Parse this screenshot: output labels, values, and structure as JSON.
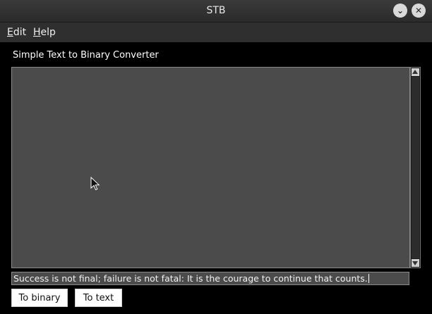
{
  "window": {
    "title": "STB"
  },
  "controls": {
    "minimize_icon": "⌄",
    "close_icon": "✕"
  },
  "menubar": {
    "edit": {
      "mnemonic": "E",
      "rest": "dit"
    },
    "help": {
      "mnemonic": "H",
      "rest": "elp"
    }
  },
  "main": {
    "heading": "Simple Text to Binary Converter",
    "output_text": "",
    "input_value": "Success is not final; failure is not fatal: It is the courage to continue that counts."
  },
  "buttons": {
    "to_binary": "To binary",
    "to_text": "To text"
  }
}
